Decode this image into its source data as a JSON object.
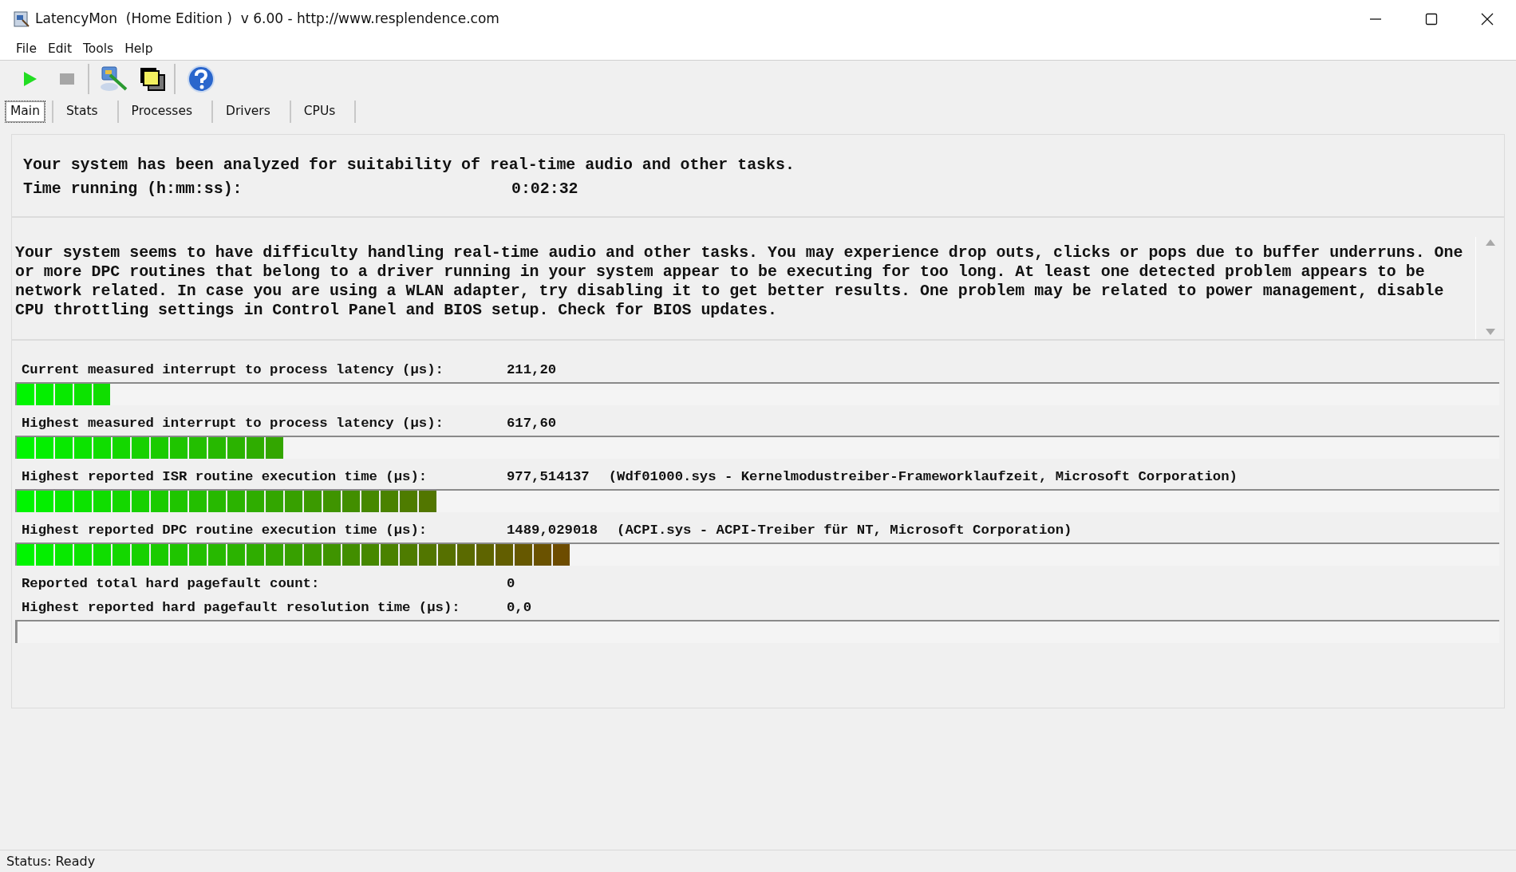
{
  "window": {
    "title": "LatencyMon  (Home Edition )  v 6.00 - http://www.resplendence.com"
  },
  "menu": [
    "File",
    "Edit",
    "Tools",
    "Help"
  ],
  "toolbar": [
    {
      "kind": "play",
      "disabled": false
    },
    {
      "kind": "stop",
      "disabled": true
    },
    {
      "kind": "separator"
    },
    {
      "kind": "tool"
    },
    {
      "kind": "windows"
    },
    {
      "kind": "separator"
    },
    {
      "kind": "help"
    }
  ],
  "tabs": [
    {
      "label": "Main",
      "selected": true
    },
    {
      "label": "Stats",
      "selected": false
    },
    {
      "label": "Processes",
      "selected": false
    },
    {
      "label": "Drivers",
      "selected": false
    },
    {
      "label": "CPUs",
      "selected": false
    }
  ],
  "summary": {
    "text": "Your system has been analyzed for suitability of real-time audio and other tasks.",
    "time_label": "Time running (h:mm:ss):",
    "time_value": "0:02:32"
  },
  "message": "Your system seems to have difficulty handling real-time audio and other tasks. You may experience drop outs, clicks or pops due to buffer underruns. One or more DPC routines that belong to a driver running in your system appear to be executing for too long. At least one detected problem appears to be network related. In case you are using a WLAN adapter, try disabling it to get better results. One problem may be related to power management, disable CPU throttling settings in Control Panel and BIOS setup. Check for BIOS updates.",
  "measurements": [
    {
      "label": "Current measured interrupt to process latency (µs):",
      "value": "211,20",
      "level": 0.063
    },
    {
      "label": "Highest measured interrupt to process latency (µs):",
      "value": "617,60",
      "level": 0.18
    },
    {
      "label": "Highest reported ISR routine execution time (µs):",
      "value": "977,514137",
      "detail": "(Wdf01000.sys - Kernelmodustreiber-Frameworklaufzeit, Microsoft Corporation)",
      "level": 0.283
    },
    {
      "label": "Highest reported DPC routine execution time (µs):",
      "value": "1489,029018",
      "detail": "(ACPI.sys - ACPI-Treiber für NT, Microsoft Corporation)",
      "level": 0.373
    },
    {
      "label": "Reported total hard pagefault count:",
      "value": "0"
    },
    {
      "label": "Highest reported hard pagefault resolution time (µs):",
      "value": "0,0",
      "level": 0
    }
  ],
  "status_bar": "Status: Ready"
}
